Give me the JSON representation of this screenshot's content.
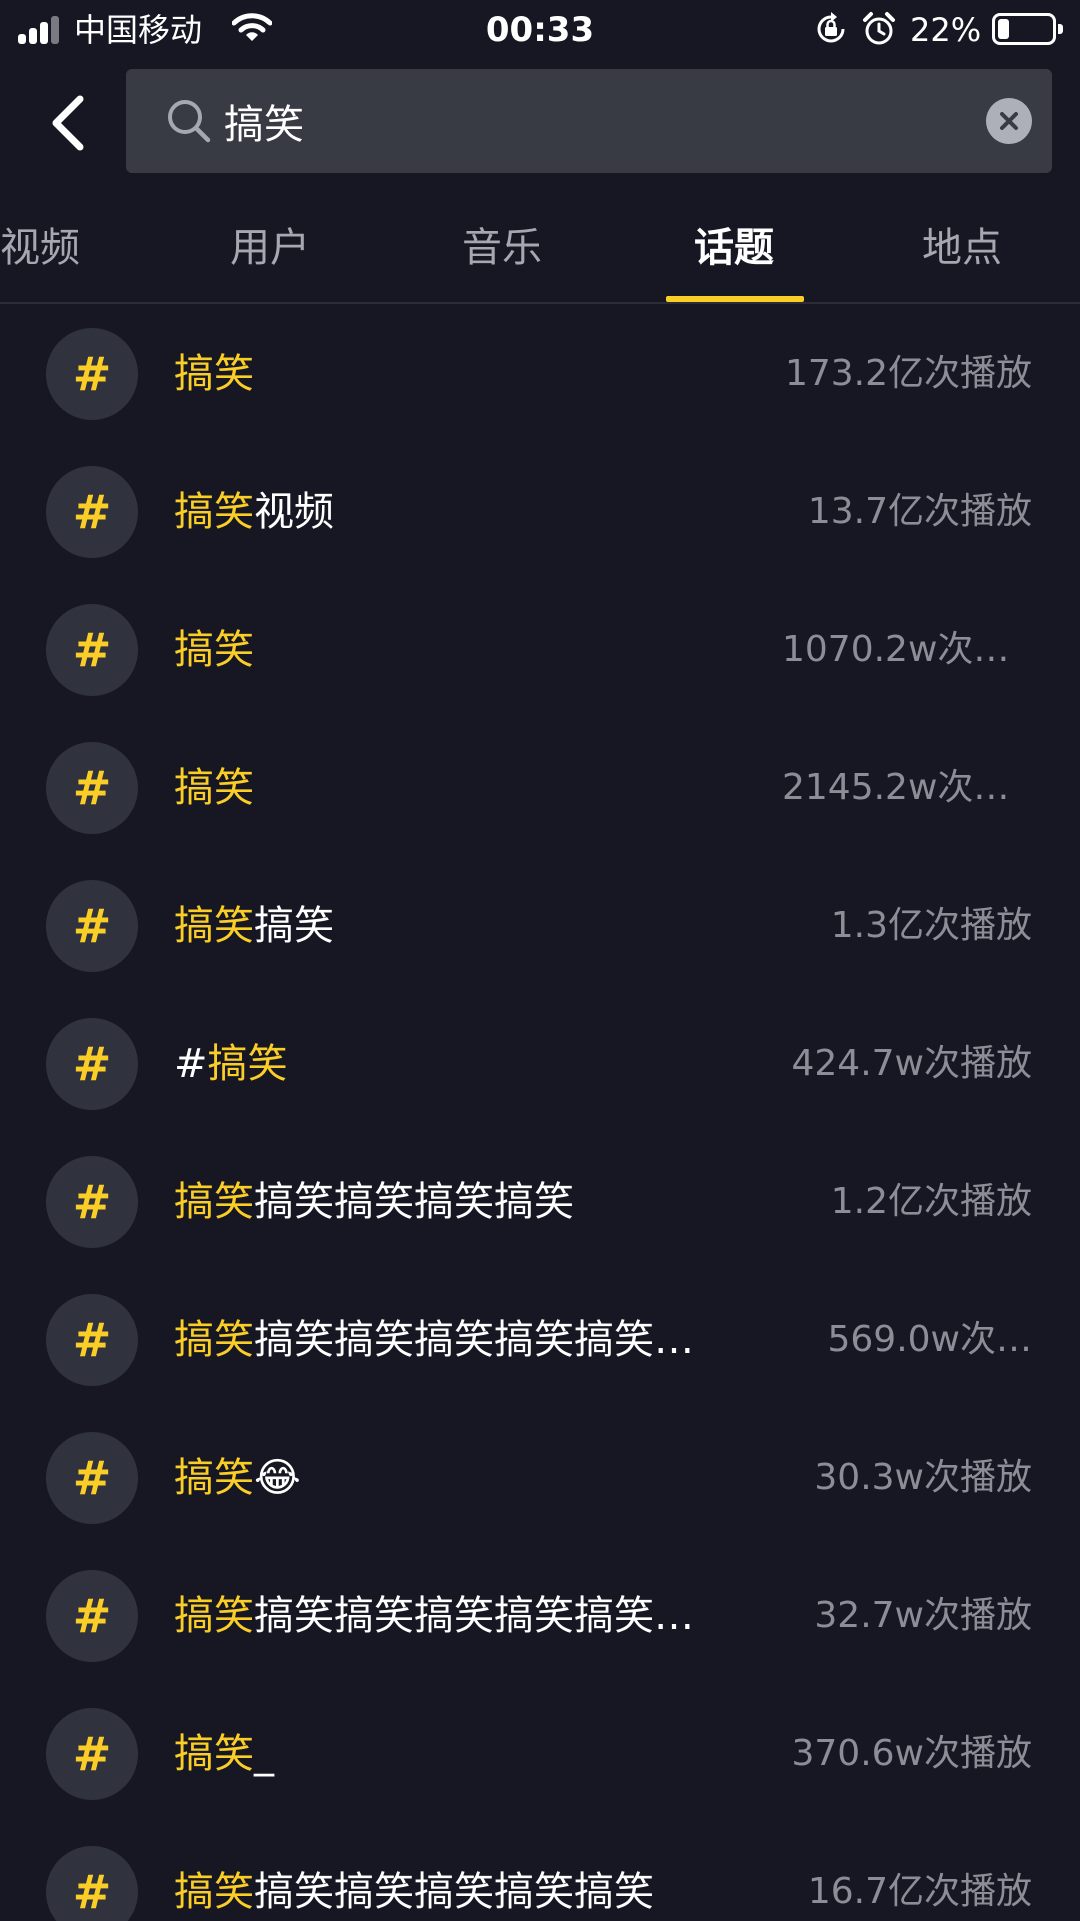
{
  "status_bar": {
    "carrier": "中国移动",
    "time": "00:33",
    "battery_percent": "22%",
    "battery_level": 0.22,
    "signal_bars_active": 3,
    "icons": [
      "signal-icon",
      "wifi-icon",
      "rotation-lock-icon",
      "alarm-icon",
      "battery-icon"
    ]
  },
  "search": {
    "query": "搞笑",
    "icons": [
      "back-arrow-icon",
      "search-icon",
      "clear-icon"
    ]
  },
  "tabs": [
    {
      "label": "视频"
    },
    {
      "label": "用户"
    },
    {
      "label": "音乐"
    },
    {
      "label": "话题"
    },
    {
      "label": "地点"
    }
  ],
  "active_tab": "话题",
  "colors": {
    "background": "#161722",
    "accent": "#fbce27",
    "search_bg": "#383a44",
    "badge_bg": "#30323d",
    "muted_text": "#8c8e97"
  },
  "topics": [
    {
      "hash": "#",
      "prefix": "",
      "highlight": "搞笑",
      "suffix": "",
      "count": "173.2亿次播放"
    },
    {
      "hash": "#",
      "prefix": "",
      "highlight": "搞笑",
      "suffix": "视频",
      "count": "13.7亿次播放"
    },
    {
      "hash": "#",
      "prefix": "",
      "highlight": "搞笑",
      "suffix": "",
      "count": "1070.2w次播放"
    },
    {
      "hash": "#",
      "prefix": "",
      "highlight": "搞笑",
      "suffix": "",
      "count": "2145.2w次播放"
    },
    {
      "hash": "#",
      "prefix": "",
      "highlight": "搞笑",
      "suffix": "搞笑",
      "count": "1.3亿次播放"
    },
    {
      "hash": "#",
      "prefix": "#",
      "highlight": "搞笑",
      "suffix": "",
      "count": "424.7w次播放"
    },
    {
      "hash": "#",
      "prefix": "",
      "highlight": "搞笑",
      "suffix": "搞笑搞笑搞笑搞笑",
      "count": "1.2亿次播放"
    },
    {
      "hash": "#",
      "prefix": "",
      "highlight": "搞笑",
      "suffix": "搞笑搞笑搞笑搞笑搞笑…",
      "count": "569.0w次…"
    },
    {
      "hash": "#",
      "prefix": "",
      "highlight": "搞笑",
      "suffix": "😂",
      "count": "30.3w次播放"
    },
    {
      "hash": "#",
      "prefix": "",
      "highlight": "搞笑",
      "suffix": "搞笑搞笑搞笑搞笑搞笑…",
      "count": "32.7w次播放"
    },
    {
      "hash": "#",
      "prefix": "",
      "highlight": "搞笑",
      "suffix": "_",
      "count": "370.6w次播放"
    },
    {
      "hash": "#",
      "prefix": "",
      "highlight": "搞笑",
      "suffix": "搞笑搞笑搞笑搞笑搞笑",
      "count": "16.7亿次播放"
    }
  ]
}
